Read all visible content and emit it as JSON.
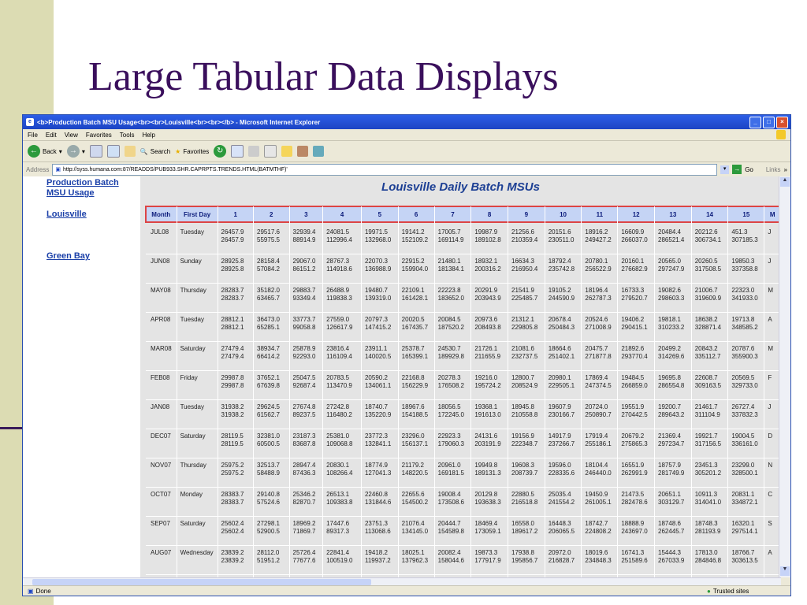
{
  "slide": {
    "title": "Large Tabular Data Displays"
  },
  "browser": {
    "window_title": "<b>Production Batch MSU Usage<br><br>Louisville<br><br></b> - Microsoft Internet Explorer",
    "menu": [
      "File",
      "Edit",
      "View",
      "Favorites",
      "Tools",
      "Help"
    ],
    "toolbar": {
      "back": "Back",
      "search": "Search",
      "favorites": "Favorites"
    },
    "address_label": "Address",
    "url": "http://syss.humana.com:87/READDS/PUB933.SHR.CAPRPTS.TRENDS.HTML(BATMTHF)'",
    "go_label": "Go",
    "links_label": "Links",
    "status_left": "Done",
    "status_right": "Trusted sites"
  },
  "sidebar": {
    "heading": "Production Batch MSU Usage",
    "links": [
      "Louisville",
      "Green Bay"
    ]
  },
  "report": {
    "title": "Louisville Daily Batch MSUs",
    "columns": [
      "Month",
      "First Day",
      "1",
      "2",
      "3",
      "4",
      "5",
      "6",
      "7",
      "8",
      "9",
      "10",
      "11",
      "12",
      "13",
      "14",
      "15",
      "M"
    ],
    "rows": [
      {
        "month": "JUL08",
        "day": "Tuesday",
        "cells": [
          [
            "26457.9",
            "26457.9"
          ],
          [
            "29517.6",
            "55975.5"
          ],
          [
            "32939.4",
            "88914.9"
          ],
          [
            "24081.5",
            "112996.4"
          ],
          [
            "19971.5",
            "132968.0"
          ],
          [
            "19141.2",
            "152109.2"
          ],
          [
            "17005.7",
            "169114.9"
          ],
          [
            "19987.9",
            "189102.8"
          ],
          [
            "21256.6",
            "210359.4"
          ],
          [
            "20151.6",
            "230511.0"
          ],
          [
            "18916.2",
            "249427.2"
          ],
          [
            "16609.9",
            "266037.0"
          ],
          [
            "20484.4",
            "286521.4"
          ],
          [
            "20212.6",
            "306734.1"
          ],
          [
            "451.3",
            "307185.3"
          ]
        ],
        "tail": "J"
      },
      {
        "month": "JUN08",
        "day": "Sunday",
        "cells": [
          [
            "28925.8",
            "28925.8"
          ],
          [
            "28158.4",
            "57084.2"
          ],
          [
            "29067.0",
            "86151.2"
          ],
          [
            "28767.3",
            "114918.6"
          ],
          [
            "22070.3",
            "136988.9"
          ],
          [
            "22915.2",
            "159904.0"
          ],
          [
            "21480.1",
            "181384.1"
          ],
          [
            "18932.1",
            "200316.2"
          ],
          [
            "16634.3",
            "216950.4"
          ],
          [
            "18792.4",
            "235742.8"
          ],
          [
            "20780.1",
            "256522.9"
          ],
          [
            "20160.1",
            "276682.9"
          ],
          [
            "20565.0",
            "297247.9"
          ],
          [
            "20260.5",
            "317508.5"
          ],
          [
            "19850.3",
            "337358.8"
          ]
        ],
        "tail": "J"
      },
      {
        "month": "MAY08",
        "day": "Thursday",
        "cells": [
          [
            "28283.7",
            "28283.7"
          ],
          [
            "35182.0",
            "63465.7"
          ],
          [
            "29883.7",
            "93349.4"
          ],
          [
            "26488.9",
            "119838.3"
          ],
          [
            "19480.7",
            "139319.0"
          ],
          [
            "22109.1",
            "161428.1"
          ],
          [
            "22223.8",
            "183652.0"
          ],
          [
            "20291.9",
            "203943.9"
          ],
          [
            "21541.9",
            "225485.7"
          ],
          [
            "19105.2",
            "244590.9"
          ],
          [
            "18196.4",
            "262787.3"
          ],
          [
            "16733.3",
            "279520.7"
          ],
          [
            "19082.6",
            "298603.3"
          ],
          [
            "21006.7",
            "319609.9"
          ],
          [
            "22323.0",
            "341933.0"
          ]
        ],
        "tail": "M"
      },
      {
        "month": "APR08",
        "day": "Tuesday",
        "cells": [
          [
            "28812.1",
            "28812.1"
          ],
          [
            "36473.0",
            "65285.1"
          ],
          [
            "33773.7",
            "99058.8"
          ],
          [
            "27559.0",
            "126617.9"
          ],
          [
            "20797.3",
            "147415.2"
          ],
          [
            "20020.5",
            "167435.7"
          ],
          [
            "20084.5",
            "187520.2"
          ],
          [
            "20973.6",
            "208493.8"
          ],
          [
            "21312.1",
            "229805.8"
          ],
          [
            "20678.4",
            "250484.3"
          ],
          [
            "20524.6",
            "271008.9"
          ],
          [
            "19406.2",
            "290415.1"
          ],
          [
            "19818.1",
            "310233.2"
          ],
          [
            "18638.2",
            "328871.4"
          ],
          [
            "19713.8",
            "348585.2"
          ]
        ],
        "tail": "A"
      },
      {
        "month": "MAR08",
        "day": "Saturday",
        "cells": [
          [
            "27479.4",
            "27479.4"
          ],
          [
            "38934.7",
            "66414.2"
          ],
          [
            "25878.9",
            "92293.0"
          ],
          [
            "23816.4",
            "116109.4"
          ],
          [
            "23911.1",
            "140020.5"
          ],
          [
            "25378.7",
            "165399.1"
          ],
          [
            "24530.7",
            "189929.8"
          ],
          [
            "21726.1",
            "211655.9"
          ],
          [
            "21081.6",
            "232737.5"
          ],
          [
            "18664.6",
            "251402.1"
          ],
          [
            "20475.7",
            "271877.8"
          ],
          [
            "21892.6",
            "293770.4"
          ],
          [
            "20499.2",
            "314269.6"
          ],
          [
            "20843.2",
            "335112.7"
          ],
          [
            "20787.6",
            "355900.3"
          ]
        ],
        "tail": "M"
      },
      {
        "month": "FEB08",
        "day": "Friday",
        "cells": [
          [
            "29987.8",
            "29987.8"
          ],
          [
            "37652.1",
            "67639.8"
          ],
          [
            "25047.5",
            "92687.4"
          ],
          [
            "20783.5",
            "113470.9"
          ],
          [
            "20590.2",
            "134061.1"
          ],
          [
            "22168.8",
            "156229.9"
          ],
          [
            "20278.3",
            "176508.2"
          ],
          [
            "19216.0",
            "195724.2"
          ],
          [
            "12800.7",
            "208524.9"
          ],
          [
            "20980.1",
            "229505.1"
          ],
          [
            "17869.4",
            "247374.5"
          ],
          [
            "19484.5",
            "266859.0"
          ],
          [
            "19695.8",
            "286554.8"
          ],
          [
            "22608.7",
            "309163.5"
          ],
          [
            "20569.5",
            "329733.0"
          ]
        ],
        "tail": "F"
      },
      {
        "month": "JAN08",
        "day": "Tuesday",
        "cells": [
          [
            "31938.2",
            "31938.2"
          ],
          [
            "29624.5",
            "61562.7"
          ],
          [
            "27674.8",
            "89237.5"
          ],
          [
            "27242.8",
            "116480.2"
          ],
          [
            "18740.7",
            "135220.9"
          ],
          [
            "18967.6",
            "154188.5"
          ],
          [
            "18056.5",
            "172245.0"
          ],
          [
            "19368.1",
            "191613.0"
          ],
          [
            "18945.8",
            "210558.8"
          ],
          [
            "19607.9",
            "230166.7"
          ],
          [
            "20724.0",
            "250890.7"
          ],
          [
            "19551.9",
            "270442.5"
          ],
          [
            "19200.7",
            "289643.2"
          ],
          [
            "21461.7",
            "311104.9"
          ],
          [
            "26727.4",
            "337832.3"
          ]
        ],
        "tail": "J"
      },
      {
        "month": "DEC07",
        "day": "Saturday",
        "cells": [
          [
            "28119.5",
            "28119.5"
          ],
          [
            "32381.0",
            "60500.5"
          ],
          [
            "23187.3",
            "83687.8"
          ],
          [
            "25381.0",
            "109068.8"
          ],
          [
            "23772.3",
            "132841.1"
          ],
          [
            "23296.0",
            "156137.1"
          ],
          [
            "22923.3",
            "179060.3"
          ],
          [
            "24131.6",
            "203191.9"
          ],
          [
            "19156.9",
            "222348.7"
          ],
          [
            "14917.9",
            "237266.7"
          ],
          [
            "17919.4",
            "255186.1"
          ],
          [
            "20679.2",
            "275865.3"
          ],
          [
            "21369.4",
            "297234.7"
          ],
          [
            "19921.7",
            "317156.5"
          ],
          [
            "19004.5",
            "336161.0"
          ]
        ],
        "tail": "D"
      },
      {
        "month": "NOV07",
        "day": "Thursday",
        "cells": [
          [
            "25975.2",
            "25975.2"
          ],
          [
            "32513.7",
            "58488.9"
          ],
          [
            "28947.4",
            "87436.3"
          ],
          [
            "20830.1",
            "108266.4"
          ],
          [
            "18774.9",
            "127041.3"
          ],
          [
            "21179.2",
            "148220.5"
          ],
          [
            "20961.0",
            "169181.5"
          ],
          [
            "19949.8",
            "189131.3"
          ],
          [
            "19608.3",
            "208739.7"
          ],
          [
            "19596.0",
            "228335.6"
          ],
          [
            "18104.4",
            "246440.0"
          ],
          [
            "16551.9",
            "262991.9"
          ],
          [
            "18757.9",
            "281749.9"
          ],
          [
            "23451.3",
            "305201.2"
          ],
          [
            "23299.0",
            "328500.1"
          ]
        ],
        "tail": "N"
      },
      {
        "month": "OCT07",
        "day": "Monday",
        "cells": [
          [
            "28383.7",
            "28383.7"
          ],
          [
            "29140.8",
            "57524.6"
          ],
          [
            "25346.2",
            "82870.7"
          ],
          [
            "26513.1",
            "109383.8"
          ],
          [
            "22460.8",
            "131844.6"
          ],
          [
            "22655.6",
            "154500.2"
          ],
          [
            "19008.4",
            "173508.6"
          ],
          [
            "20129.8",
            "193638.3"
          ],
          [
            "22880.5",
            "216518.8"
          ],
          [
            "25035.4",
            "241554.2"
          ],
          [
            "19450.9",
            "261005.1"
          ],
          [
            "21473.5",
            "282478.6"
          ],
          [
            "20651.1",
            "303129.7"
          ],
          [
            "10911.3",
            "314041.0"
          ],
          [
            "20831.1",
            "334872.1"
          ]
        ],
        "tail": "C"
      },
      {
        "month": "SEP07",
        "day": "Saturday",
        "cells": [
          [
            "25602.4",
            "25602.4"
          ],
          [
            "27298.1",
            "52900.5"
          ],
          [
            "18969.2",
            "71869.7"
          ],
          [
            "17447.6",
            "89317.3"
          ],
          [
            "23751.3",
            "113068.6"
          ],
          [
            "21076.4",
            "134145.0"
          ],
          [
            "20444.7",
            "154589.8"
          ],
          [
            "18469.4",
            "173059.1"
          ],
          [
            "16558.0",
            "189617.2"
          ],
          [
            "16448.3",
            "206065.5"
          ],
          [
            "18742.7",
            "224808.2"
          ],
          [
            "18888.9",
            "243697.0"
          ],
          [
            "18748.6",
            "262445.7"
          ],
          [
            "18748.3",
            "281193.9"
          ],
          [
            "16320.1",
            "297514.1"
          ]
        ],
        "tail": "S"
      },
      {
        "month": "AUG07",
        "day": "Wednesday",
        "cells": [
          [
            "23839.2",
            "23839.2"
          ],
          [
            "28112.0",
            "51951.2"
          ],
          [
            "25726.4",
            "77677.6"
          ],
          [
            "22841.4",
            "100519.0"
          ],
          [
            "19418.2",
            "119937.2"
          ],
          [
            "18025.1",
            "137962.3"
          ],
          [
            "20082.4",
            "158044.6"
          ],
          [
            "19873.3",
            "177917.9"
          ],
          [
            "17938.8",
            "195856.7"
          ],
          [
            "20972.0",
            "216828.7"
          ],
          [
            "18019.6",
            "234848.3"
          ],
          [
            "16741.3",
            "251589.6"
          ],
          [
            "15444.3",
            "267033.9"
          ],
          [
            "17813.0",
            "284846.8"
          ],
          [
            "18766.7",
            "303613.5"
          ]
        ],
        "tail": "A"
      },
      {
        "month": "JUL07",
        "day": "Sunday",
        "cells": [
          [
            "24643.7",
            "24643.7"
          ],
          [
            "22867.2",
            "47510.9"
          ],
          [
            "24097.3",
            "71608.2"
          ],
          [
            "21563.3",
            "93171.5"
          ],
          [
            "17854.0",
            "111025.4"
          ],
          [
            "19275.9",
            "130301.3"
          ],
          [
            "16741.3",
            "147042.5"
          ],
          [
            "16022.5",
            "163065.1"
          ],
          [
            "14457.4",
            "177522.4"
          ],
          [
            "16733.8",
            "194256.2"
          ],
          [
            "19295.7",
            "213551.9"
          ],
          [
            "18738.7",
            "232290.6"
          ],
          [
            "15304.6",
            "247595.2"
          ],
          [
            "10502.6",
            "258097.8"
          ],
          [
            "17656.3",
            "275754.2"
          ]
        ],
        "tail": "J"
      },
      {
        "month": "JUN07",
        "day": "Friday",
        "cells": [
          [
            "24919.2",
            "24919.2"
          ],
          [
            "21060.7",
            "45979.9"
          ],
          [
            "20477.8",
            "66457.7"
          ],
          [
            "19456.8",
            "85914.5"
          ],
          [
            "18374.8",
            "104289.3"
          ],
          [
            "20667.0",
            "124956.2"
          ],
          [
            "20003.3",
            "144959.5"
          ],
          [
            "17517.7",
            "162477.2"
          ],
          [
            "16598.3",
            "179075.5"
          ],
          [
            "15956.6",
            "195032.1"
          ],
          [
            "14079.6",
            "209111.7"
          ],
          [
            "15599.5",
            "224711.3"
          ],
          [
            "17779.0",
            "242490.3"
          ],
          [
            "17549.7",
            "260040.0"
          ],
          [
            "17284.4",
            "277324.4"
          ]
        ],
        "tail": "J"
      }
    ]
  }
}
